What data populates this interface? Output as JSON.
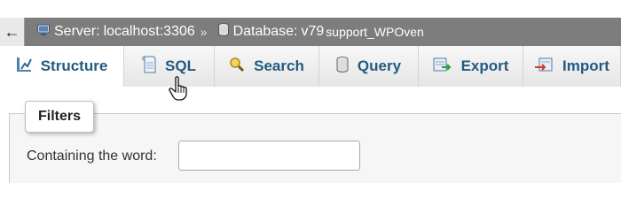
{
  "breadcrumb": {
    "back_symbol": "←",
    "server_label": "Server:",
    "server_value": "localhost:3306",
    "separator": "»",
    "database_label": "Database:",
    "database_value": "v79",
    "database_suffix": "support_WPOven",
    "server_icon": "server-icon",
    "database_icon": "database-icon"
  },
  "tabs": [
    {
      "label": "Structure",
      "icon": "structure-icon",
      "active": true
    },
    {
      "label": "SQL",
      "icon": "sql-icon",
      "active": false
    },
    {
      "label": "Search",
      "icon": "search-icon",
      "active": false
    },
    {
      "label": "Query",
      "icon": "query-icon",
      "active": false
    },
    {
      "label": "Export",
      "icon": "export-icon",
      "active": false
    },
    {
      "label": "Import",
      "icon": "import-icon",
      "active": false
    }
  ],
  "filters": {
    "legend": "Filters",
    "field_label": "Containing the word:",
    "input_value": ""
  },
  "colors": {
    "breadcrumb_bg": "#7d7d7d",
    "tab_text": "#235a81",
    "panel_bg": "#f6f6f6"
  }
}
